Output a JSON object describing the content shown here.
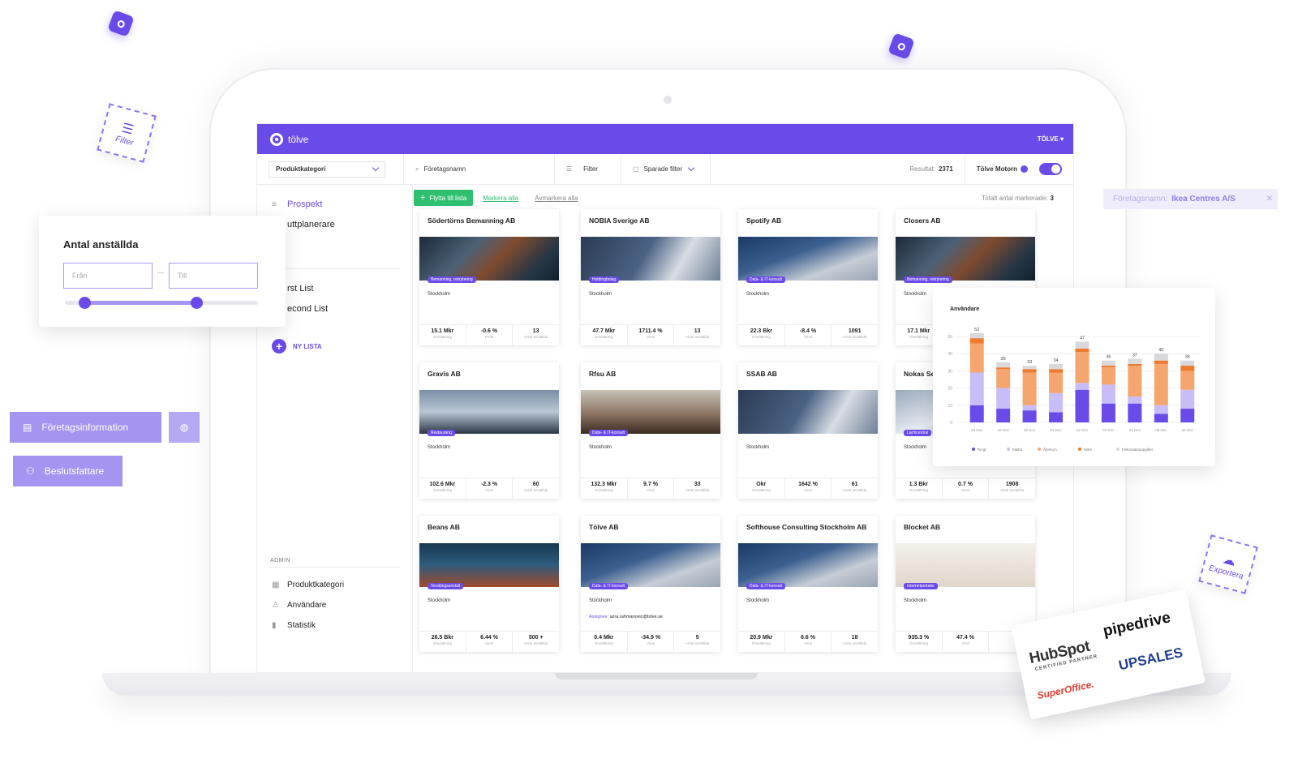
{
  "app": {
    "logo_text": "tölve",
    "user_menu": "TÖLVE ▾"
  },
  "filterbar": {
    "category_select": "Produktkategori",
    "search_placeholder": "Företagsnamn",
    "filter_label": "Filter",
    "saved_filter_label": "Sparade filter",
    "result_label": "Resultat:",
    "result_count": "2371",
    "motor_label": "Tölve Motorn"
  },
  "sidebar": {
    "items": [
      "Prospekt",
      "Utskickplanerare",
      "First List",
      "Second List"
    ],
    "visible_items": [
      "Prospekt",
      "uttplanerare",
      "rst List",
      "econd List"
    ],
    "new_list": "NY LISTA",
    "admin_heading": "ADMIN",
    "admin_items": [
      "Produktkategori",
      "Användare",
      "Statistik"
    ]
  },
  "actions": {
    "move_to_list": "Flytta till lista",
    "select_all": "Markera alla",
    "deselect_all": "Avmarkera alla",
    "total_marked_label": "Totalt antal markerade:",
    "total_marked_value": "3"
  },
  "cards": [
    {
      "name": "Södertörns Bemanning AB",
      "tag": "Bemanning, rekrytering",
      "city": "Stockholm",
      "s1": "15.1 Mkr",
      "l1": "Omsättning",
      "s2": "-0.6 %",
      "l2": "Profit",
      "s3": "13",
      "l3": "Antal anställda",
      "img": "bg-a"
    },
    {
      "name": "NOBIA Sverige AB",
      "tag": "Holdingbolag",
      "city": "Stockholm",
      "s1": "47.7 Mkr",
      "l1": "Omsättning",
      "s2": "1711.4 %",
      "l2": "Vinst",
      "s3": "13",
      "l3": "Antal anställda",
      "img": "bg-b"
    },
    {
      "name": "Spotify AB",
      "tag": "Data- & IT-konsult",
      "city": "Stockholm",
      "s1": "22.3 Bkr",
      "l1": "Omsättning",
      "s2": "-8.4 %",
      "l2": "Vinst",
      "s3": "1091",
      "l3": "Antal anställda",
      "img": "bg-c"
    },
    {
      "name": "Closers AB",
      "tag": "Bemanning, rekrytering",
      "city": "Stockholm",
      "s1": "17.1 Mkr",
      "l1": "Omsättning",
      "s2": "",
      "l2": "",
      "s3": "",
      "l3": "",
      "img": "bg-a"
    },
    {
      "name": "Gravis AB",
      "tag": "Restaurang",
      "city": "Stockholm",
      "s1": "102.6 Mkr",
      "l1": "Omsättning",
      "s2": "-2.3 %",
      "l2": "Vinst",
      "s3": "60",
      "l3": "Antal anställda",
      "img": "bg-d"
    },
    {
      "name": "Rfsu AB",
      "tag": "Data- & IT-konsult",
      "city": "Stockholm",
      "s1": "132.3 Mkr",
      "l1": "Omsättning",
      "s2": "9.7 %",
      "l2": "Vinst",
      "s3": "33",
      "l3": "Antal anställda",
      "img": "bg-e"
    },
    {
      "name": "SSAB AB",
      "tag": "",
      "city": "Stockholm",
      "s1": "Okr",
      "l1": "Omsättning",
      "s2": "1642 %",
      "l2": "Vinst",
      "s3": "61",
      "l3": "Antal anställda",
      "img": "bg-b"
    },
    {
      "name": "Nokas Secur",
      "tag": "Larmcentral",
      "city": "Stockholm",
      "s1": "1.3 Bkr",
      "l1": "Omsättning",
      "s2": "0.7 %",
      "l2": "Vinst",
      "s3": "1908",
      "l3": "Antal anställda",
      "img": "bg-f"
    },
    {
      "name": "Beans AB",
      "tag": "Verstlingsanstalt",
      "city": "Stockholm",
      "s1": "26.5 Bkr",
      "l1": "Omsättning",
      "s2": "6.44 %",
      "l2": "Vinst",
      "s3": "500 +",
      "l3": "Antal anställda",
      "img": "bg-g"
    },
    {
      "name": "Tölve AB",
      "tag": "Data- & IT-konsult",
      "city": "Stockholm",
      "s1": "0.4 Mkr",
      "l1": "Omsättning",
      "s2": "-34.9 %",
      "l2": "Vinst",
      "s3": "5",
      "l3": "Antal anställda",
      "img": "bg-c",
      "assignee_label": "Assignee:",
      "assignee": "azra.rahmanovic@tolve.se"
    },
    {
      "name": "Softhouse Consulting Stockholm AB",
      "tag": "Data- & IT-konsult",
      "city": "Stockholm",
      "s1": "20.9 Mkr",
      "l1": "Omsättning",
      "s2": "6.6 %",
      "l2": "Vinst",
      "s3": "18",
      "l3": "Antal anställda",
      "img": "bg-c"
    },
    {
      "name": "Blocket AB",
      "tag": "Internetportaler",
      "city": "Stockholm",
      "s1": "935.3 %",
      "l1": "Omsättning",
      "s2": "47.4 %",
      "l2": "Vinst",
      "s3": "",
      "l3": "",
      "img": "bg-h"
    }
  ],
  "range_widget": {
    "title": "Antal anställda",
    "from_placeholder": "Från",
    "to_placeholder": "Till",
    "range": [
      0.1,
      0.68
    ]
  },
  "pills": {
    "company_info": "Företagsinformation",
    "decision_makers": "Beslutsfattare"
  },
  "chip": {
    "label": "Företagsnamn:",
    "value": "Ikea Centres A/S"
  },
  "deco_labels": {
    "filter": "Filter",
    "export": "Exportera"
  },
  "partners": {
    "hubspot": "HubSpot",
    "hubspot_sub": "CERTIFIED PARTNER",
    "pipedrive": "pipedrive",
    "superoffice": "SuperOffice.",
    "upsales": "UPSALES"
  },
  "colors": {
    "brand": "#6a4bea",
    "green": "#2fbf71",
    "orange": "#f5a66e",
    "lavender": "#c9bdf7",
    "darkorange": "#ef7a2e",
    "grey": "#d8d8dd"
  },
  "chart_data": {
    "type": "bar",
    "title": "Användare",
    "categories": [
      "28 Nov",
      "29 Nov",
      "30 Nov",
      "01 Dec",
      "02 Dec",
      "03 Dec",
      "04 Dec",
      "05 Dec",
      "06 Dec"
    ],
    "totals": [
      52,
      35,
      33,
      34,
      47,
      36,
      37,
      40,
      36
    ],
    "series": [
      {
        "name": "Ringt",
        "color": "#6a4bea",
        "values": [
          10,
          8,
          7,
          6,
          19,
          11,
          11,
          5,
          8
        ]
      },
      {
        "name": "Mailat",
        "color": "#c9bdf7",
        "values": [
          19,
          12,
          3,
          11,
          4,
          11,
          4,
          5,
          11
        ]
      },
      {
        "name": "Återkom",
        "color": "#f5a66e",
        "values": [
          17,
          11,
          19,
          12,
          18,
          10,
          18,
          24,
          11
        ]
      },
      {
        "name": "Möte",
        "color": "#ef7a2e",
        "values": [
          3,
          1,
          2,
          2,
          2,
          1,
          1,
          2,
          3
        ]
      },
      {
        "name": "Felkontaktuppgifter",
        "color": "#d8d8dd",
        "values": [
          3,
          3,
          2,
          3,
          4,
          3,
          3,
          4,
          3
        ]
      }
    ],
    "ylim": [
      0,
      50
    ],
    "yticks": [
      0,
      10,
      20,
      30,
      40,
      50
    ],
    "legend": "bottom"
  }
}
